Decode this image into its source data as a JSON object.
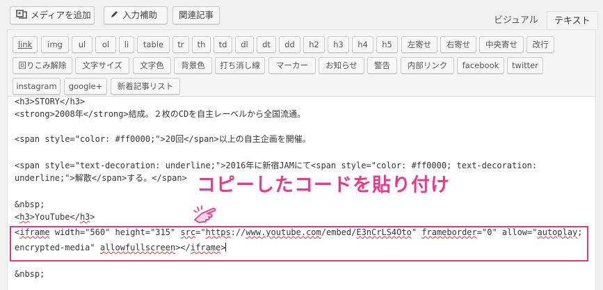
{
  "top_buttons": {
    "add_media": "メディアを追加",
    "input_assist": "入力補助",
    "related_posts": "関連記事"
  },
  "tabs": {
    "visual": "ビジュアル",
    "text": "テキスト"
  },
  "quicktags": {
    "row1": [
      "link",
      "img",
      "ul",
      "ol",
      "li",
      "table",
      "tr",
      "th",
      "td",
      "dl",
      "dt",
      "dd",
      "h2",
      "h3",
      "h4",
      "h5",
      "左寄せ",
      "右寄せ",
      "中央寄せ",
      "改行"
    ],
    "row2": [
      "回りこみ解除",
      "文字サイズ",
      "文字色",
      "背景色",
      "打ち消し線",
      "マーカー",
      "お知らせ",
      "警告",
      "内部リンク",
      "facebook",
      "twitter"
    ],
    "row3": [
      "instagram",
      "google+",
      "新着記事リスト"
    ]
  },
  "code_lines": {
    "l1": "<h3>STORY</h3>",
    "l2": "<strong>2008年</strong>結成。２枚のCDを自主レーベルから全国流通。",
    "l3": "<span style=\"color: #ff0000;\">20回</span>以上の自主企画を開催。",
    "l4": "<span style=\"text-decoration: underline;\">2016年に新宿JAMにて<span style=\"color: #ff0000; text-decoration:",
    "l5": "underline;\">解散</span>する。</span>",
    "l6": "&nbsp;",
    "l7a": "h3",
    "l7b": ">YouTube</",
    "l7c": "h3",
    "l7d": ">",
    "l8": {
      "t0": "<",
      "t1": "iframe",
      "t2": " width=\"560\" height=\"315\" ",
      "t3": "src",
      "t4": "=\"",
      "t5": "https",
      "t6": "://",
      "t7": "www.youtube.com",
      "t8": "/embed/",
      "t9": "E3nCrLS4Oto",
      "t10": "\" ",
      "t11": "frameborder",
      "t12": "=\"0\" allow=\"",
      "t13": "autoplay",
      "t14": ";"
    },
    "l9": {
      "t0": "encrypted-media\" ",
      "t1": "allowfullscreen",
      "t2": "></",
      "t3": "iframe",
      "t4": ">"
    },
    "l10": "&nbsp;"
  },
  "annotation": "コピーしたコードを貼り付け",
  "colors": {
    "accent": "#ee3787",
    "highlight_border": "#e8347f"
  }
}
